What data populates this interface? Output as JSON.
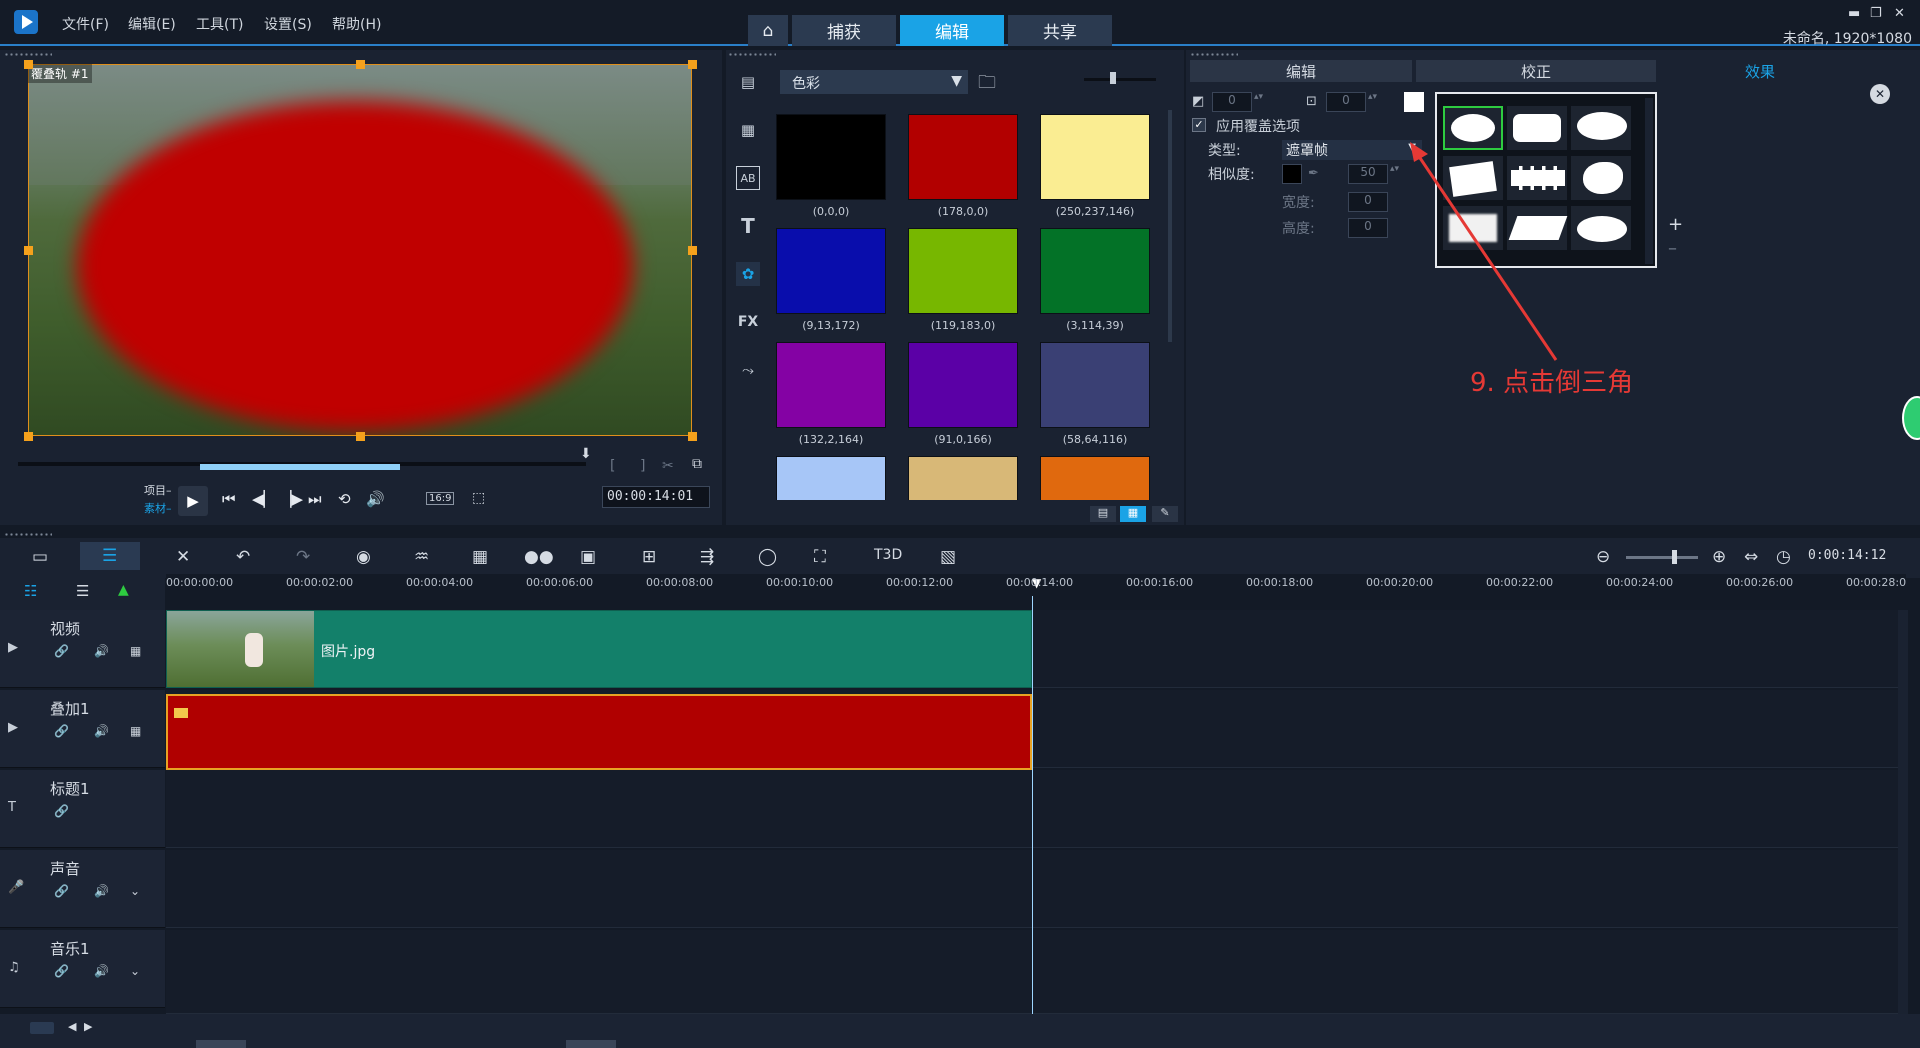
{
  "menu": [
    "文件(F)",
    "编辑(E)",
    "工具(T)",
    "设置(S)",
    "帮助(H)"
  ],
  "tabs": {
    "home": "⌂",
    "capture": "捕获",
    "edit": "编辑",
    "share": "共享"
  },
  "window": {
    "min": "▬",
    "restore": "❐",
    "close": "✕"
  },
  "project_info": "未命名, 1920*1080",
  "preview": {
    "track_tag": "覆叠轨 #1",
    "label_project": "项目–",
    "label_clip": "素材–",
    "timecode": "00:00:14:01",
    "aspect": "16:9"
  },
  "library": {
    "category": "色彩",
    "colors": [
      {
        "label": "(0,0,0)",
        "hex": "#000000"
      },
      {
        "label": "(178,0,0)",
        "hex": "#b20000"
      },
      {
        "label": "(250,237,146)",
        "hex": "#faed92"
      },
      {
        "label": "(9,13,172)",
        "hex": "#090dac"
      },
      {
        "label": "(119,183,0)",
        "hex": "#77b700"
      },
      {
        "label": "(3,114,39)",
        "hex": "#037227"
      },
      {
        "label": "(132,2,164)",
        "hex": "#8402a4"
      },
      {
        "label": "(91,0,166)",
        "hex": "#5b00a6"
      },
      {
        "label": "(58,64,116)",
        "hex": "#3a4074"
      },
      {
        "label": "",
        "hex": "#a7c6f7"
      },
      {
        "label": "",
        "hex": "#d8b877"
      },
      {
        "label": "",
        "hex": "#e0690e"
      }
    ]
  },
  "options": {
    "tabs": [
      "编辑",
      "校正",
      "效果"
    ],
    "apply_overlay": "应用覆盖选项",
    "type_label": "类型:",
    "type_value": "遮罩帧",
    "similarity_label": "相似度:",
    "similarity_value": "50",
    "width_label": "宽度:",
    "width_value": "0",
    "height_label": "高度:",
    "height_value": "0",
    "num1": "0",
    "num2": "0"
  },
  "annotation": "9. 点击倒三角",
  "timeline": {
    "timecode": "0:00:14:12",
    "ruler": [
      "00:00:00:00",
      "00:00:02:00",
      "00:00:04:00",
      "00:00:06:00",
      "00:00:08:00",
      "00:00:10:00",
      "00:00:12:00",
      "00:00:14:00",
      "00:00:16:00",
      "00:00:18:00",
      "00:00:20:00",
      "00:00:22:00",
      "00:00:24:00",
      "00:00:26:00",
      "00:00:28:0"
    ],
    "tracks": [
      {
        "name": "视频",
        "clip": "图片.jpg"
      },
      {
        "name": "叠加1"
      },
      {
        "name": "标题1"
      },
      {
        "name": "声音"
      },
      {
        "name": "音乐1"
      }
    ]
  }
}
